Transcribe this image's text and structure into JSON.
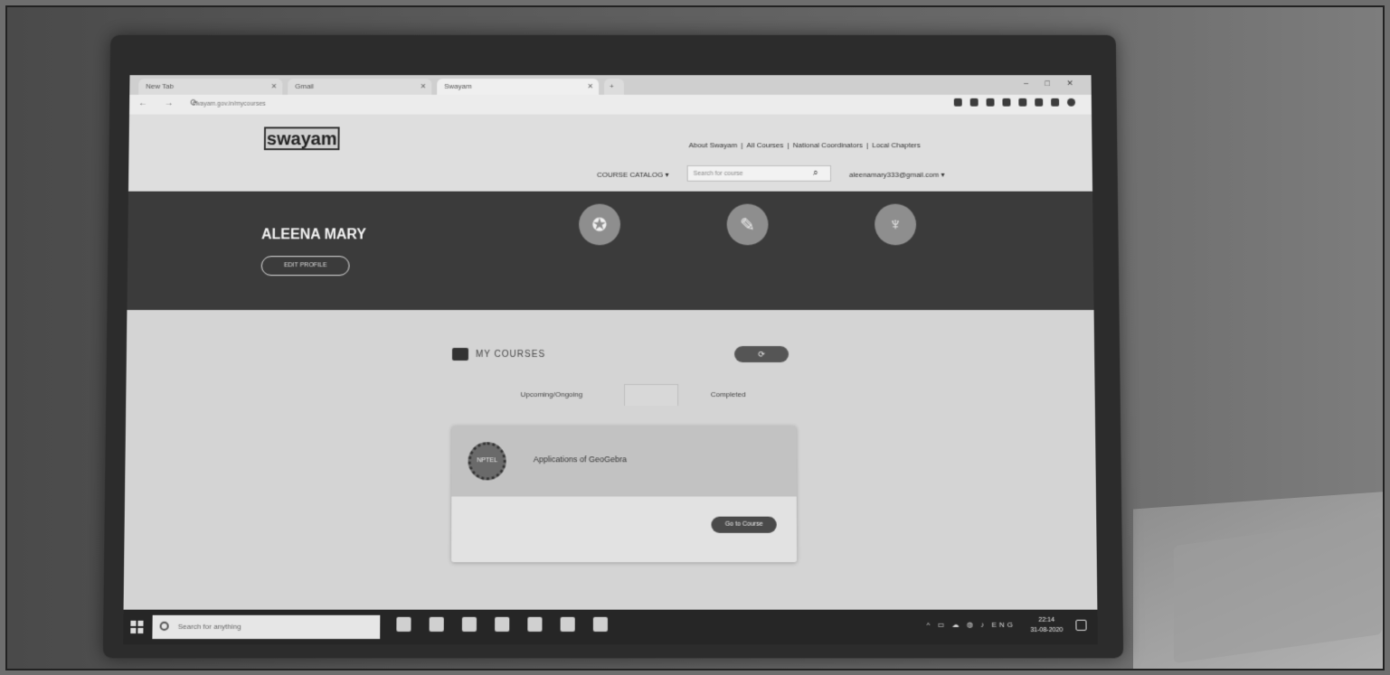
{
  "browser": {
    "tabs": [
      {
        "label": "New Tab"
      },
      {
        "label": "Gmail"
      },
      {
        "label": "Swayam"
      }
    ],
    "url": "swayam.gov.in/mycourses"
  },
  "site": {
    "logo": "swayam",
    "top_links": [
      "About Swayam",
      "All Courses",
      "National Coordinators",
      "Local Chapters"
    ],
    "course_catalog": "COURSE CATALOG",
    "search_placeholder": "Search for course",
    "user_email": "aleenamary333@gmail.com"
  },
  "profile": {
    "name": "ALEENA MARY",
    "edit_label": "EDIT PROFILE"
  },
  "my_courses": {
    "heading": "MY COURSES",
    "tabs": [
      "Upcoming/Ongoing",
      "Completed"
    ],
    "course": {
      "title": "Applications of GeoGebra",
      "action": "Go to Course"
    }
  },
  "taskbar": {
    "search_placeholder": "Search for anything",
    "tray_lang": "ENG",
    "time": "22:14",
    "date": "31-08-2020"
  }
}
